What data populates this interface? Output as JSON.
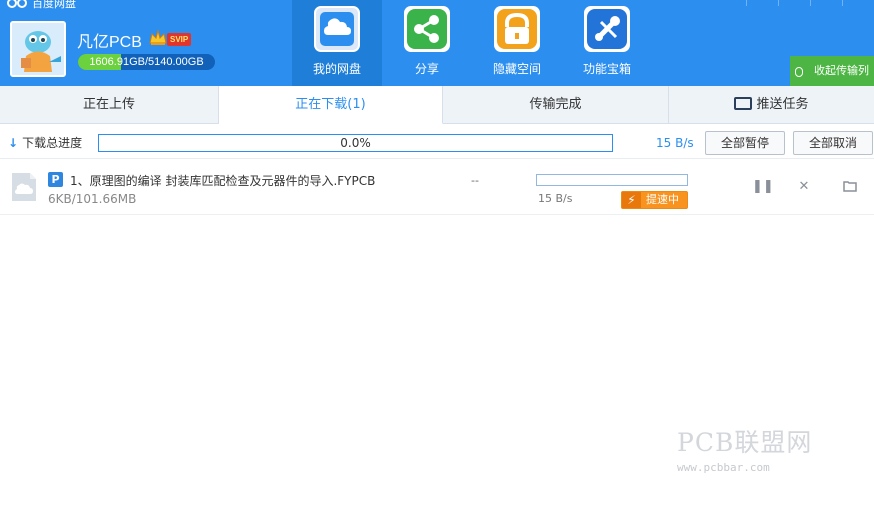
{
  "app": {
    "title": "百度网盘"
  },
  "user": {
    "name": "凡亿PCB",
    "vip_badge": "SVIP",
    "quota_text": "1606.91GB/5140.00GB",
    "quota_used_fraction": 0.3126
  },
  "nav": [
    {
      "label": "我的网盘",
      "icon": "cloud-drive-icon",
      "color": "#2c8ff0",
      "active": true
    },
    {
      "label": "分享",
      "icon": "share-icon",
      "color": "#3ab34a",
      "active": false
    },
    {
      "label": "隐藏空间",
      "icon": "lock-icon",
      "color": "#f2a21b",
      "active": false
    },
    {
      "label": "功能宝箱",
      "icon": "tools-icon",
      "color": "#2374d8",
      "active": false
    }
  ],
  "collapse": {
    "label": "收起传输列"
  },
  "tabs": [
    {
      "label": "正在上传"
    },
    {
      "label": "正在下载(1)",
      "active": true
    },
    {
      "label": "传输完成"
    },
    {
      "label": "推送任务"
    }
  ],
  "summary": {
    "label": "下载总进度",
    "progress_text": "0.0%",
    "progress_fraction": 0,
    "speed": "15 B/s",
    "pause_all": "全部暂停",
    "cancel_all": "全部取消"
  },
  "item": {
    "badge": "P",
    "name": "1、原理图的编译 封装库匹配检查及元器件的导入.FYPCB",
    "size": "6KB/101.66MB",
    "eta": "--",
    "progress_fraction": 0,
    "speed": "15 B/s",
    "boost": "提速中",
    "icons": [
      "pause-icon",
      "close-icon",
      "folder-icon"
    ]
  },
  "watermark": {
    "text": "PCB联盟网",
    "url": "www.pcbbar.com"
  },
  "colors": {
    "header": "#2c8ff0",
    "accent": "#2c8ff0",
    "boost": "#f7931e",
    "collapse": "#4cb543"
  }
}
